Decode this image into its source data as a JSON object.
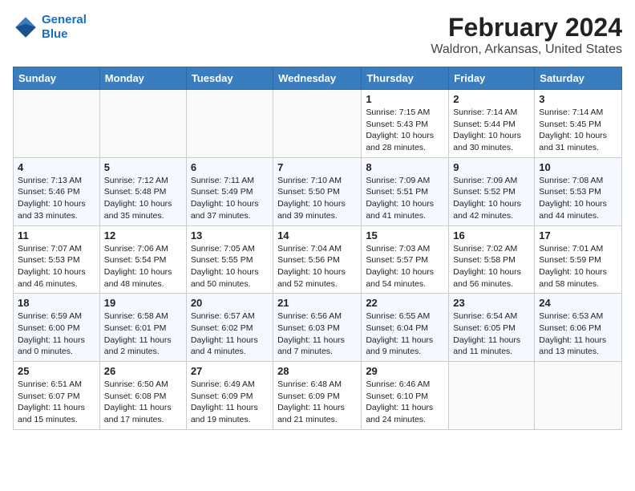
{
  "header": {
    "logo_line1": "General",
    "logo_line2": "Blue",
    "title": "February 2024",
    "subtitle": "Waldron, Arkansas, United States"
  },
  "days_of_week": [
    "Sunday",
    "Monday",
    "Tuesday",
    "Wednesday",
    "Thursday",
    "Friday",
    "Saturday"
  ],
  "weeks": [
    [
      {
        "day": "",
        "detail": ""
      },
      {
        "day": "",
        "detail": ""
      },
      {
        "day": "",
        "detail": ""
      },
      {
        "day": "",
        "detail": ""
      },
      {
        "day": "1",
        "detail": "Sunrise: 7:15 AM\nSunset: 5:43 PM\nDaylight: 10 hours\nand 28 minutes."
      },
      {
        "day": "2",
        "detail": "Sunrise: 7:14 AM\nSunset: 5:44 PM\nDaylight: 10 hours\nand 30 minutes."
      },
      {
        "day": "3",
        "detail": "Sunrise: 7:14 AM\nSunset: 5:45 PM\nDaylight: 10 hours\nand 31 minutes."
      }
    ],
    [
      {
        "day": "4",
        "detail": "Sunrise: 7:13 AM\nSunset: 5:46 PM\nDaylight: 10 hours\nand 33 minutes."
      },
      {
        "day": "5",
        "detail": "Sunrise: 7:12 AM\nSunset: 5:48 PM\nDaylight: 10 hours\nand 35 minutes."
      },
      {
        "day": "6",
        "detail": "Sunrise: 7:11 AM\nSunset: 5:49 PM\nDaylight: 10 hours\nand 37 minutes."
      },
      {
        "day": "7",
        "detail": "Sunrise: 7:10 AM\nSunset: 5:50 PM\nDaylight: 10 hours\nand 39 minutes."
      },
      {
        "day": "8",
        "detail": "Sunrise: 7:09 AM\nSunset: 5:51 PM\nDaylight: 10 hours\nand 41 minutes."
      },
      {
        "day": "9",
        "detail": "Sunrise: 7:09 AM\nSunset: 5:52 PM\nDaylight: 10 hours\nand 42 minutes."
      },
      {
        "day": "10",
        "detail": "Sunrise: 7:08 AM\nSunset: 5:53 PM\nDaylight: 10 hours\nand 44 minutes."
      }
    ],
    [
      {
        "day": "11",
        "detail": "Sunrise: 7:07 AM\nSunset: 5:53 PM\nDaylight: 10 hours\nand 46 minutes."
      },
      {
        "day": "12",
        "detail": "Sunrise: 7:06 AM\nSunset: 5:54 PM\nDaylight: 10 hours\nand 48 minutes."
      },
      {
        "day": "13",
        "detail": "Sunrise: 7:05 AM\nSunset: 5:55 PM\nDaylight: 10 hours\nand 50 minutes."
      },
      {
        "day": "14",
        "detail": "Sunrise: 7:04 AM\nSunset: 5:56 PM\nDaylight: 10 hours\nand 52 minutes."
      },
      {
        "day": "15",
        "detail": "Sunrise: 7:03 AM\nSunset: 5:57 PM\nDaylight: 10 hours\nand 54 minutes."
      },
      {
        "day": "16",
        "detail": "Sunrise: 7:02 AM\nSunset: 5:58 PM\nDaylight: 10 hours\nand 56 minutes."
      },
      {
        "day": "17",
        "detail": "Sunrise: 7:01 AM\nSunset: 5:59 PM\nDaylight: 10 hours\nand 58 minutes."
      }
    ],
    [
      {
        "day": "18",
        "detail": "Sunrise: 6:59 AM\nSunset: 6:00 PM\nDaylight: 11 hours\nand 0 minutes."
      },
      {
        "day": "19",
        "detail": "Sunrise: 6:58 AM\nSunset: 6:01 PM\nDaylight: 11 hours\nand 2 minutes."
      },
      {
        "day": "20",
        "detail": "Sunrise: 6:57 AM\nSunset: 6:02 PM\nDaylight: 11 hours\nand 4 minutes."
      },
      {
        "day": "21",
        "detail": "Sunrise: 6:56 AM\nSunset: 6:03 PM\nDaylight: 11 hours\nand 7 minutes."
      },
      {
        "day": "22",
        "detail": "Sunrise: 6:55 AM\nSunset: 6:04 PM\nDaylight: 11 hours\nand 9 minutes."
      },
      {
        "day": "23",
        "detail": "Sunrise: 6:54 AM\nSunset: 6:05 PM\nDaylight: 11 hours\nand 11 minutes."
      },
      {
        "day": "24",
        "detail": "Sunrise: 6:53 AM\nSunset: 6:06 PM\nDaylight: 11 hours\nand 13 minutes."
      }
    ],
    [
      {
        "day": "25",
        "detail": "Sunrise: 6:51 AM\nSunset: 6:07 PM\nDaylight: 11 hours\nand 15 minutes."
      },
      {
        "day": "26",
        "detail": "Sunrise: 6:50 AM\nSunset: 6:08 PM\nDaylight: 11 hours\nand 17 minutes."
      },
      {
        "day": "27",
        "detail": "Sunrise: 6:49 AM\nSunset: 6:09 PM\nDaylight: 11 hours\nand 19 minutes."
      },
      {
        "day": "28",
        "detail": "Sunrise: 6:48 AM\nSunset: 6:09 PM\nDaylight: 11 hours\nand 21 minutes."
      },
      {
        "day": "29",
        "detail": "Sunrise: 6:46 AM\nSunset: 6:10 PM\nDaylight: 11 hours\nand 24 minutes."
      },
      {
        "day": "",
        "detail": ""
      },
      {
        "day": "",
        "detail": ""
      }
    ]
  ]
}
